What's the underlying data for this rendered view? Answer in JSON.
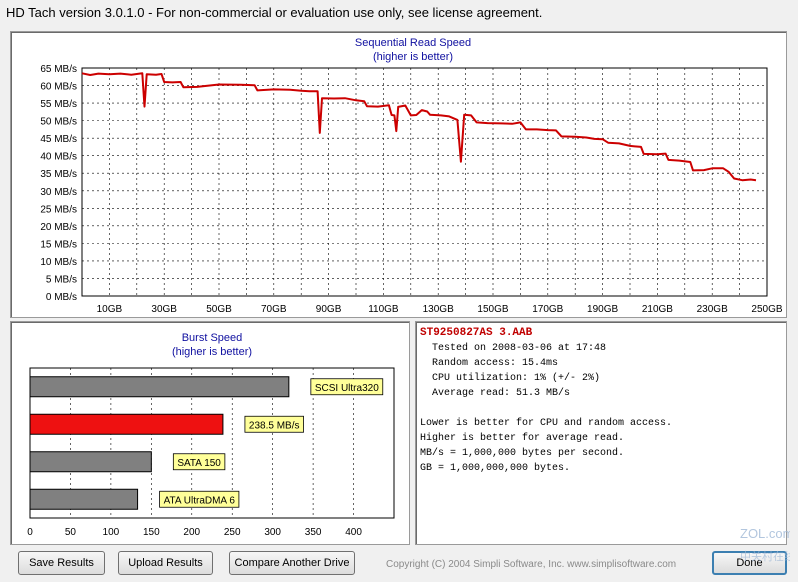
{
  "window": {
    "title": "HD Tach version 3.0.1.0  - For non-commercial or evaluation use only, see license agreement."
  },
  "chart_data": [
    {
      "type": "line",
      "title": "Sequential Read Speed",
      "subtitle": "(higher is better)",
      "xlabel": "",
      "ylabel": "",
      "x_unit": "GB",
      "y_unit": "MB/s",
      "xlim": [
        0,
        250
      ],
      "ylim": [
        0,
        65
      ],
      "grid": true,
      "y_ticks": [
        "65 MB/s",
        "60 MB/s",
        "55 MB/s",
        "50 MB/s",
        "45 MB/s",
        "40 MB/s",
        "35 MB/s",
        "30 MB/s",
        "25 MB/s",
        "20 MB/s",
        "15 MB/s",
        "10 MB/s",
        "5 MB/s",
        "0 MB/s"
      ],
      "x_ticks": [
        "10GB",
        "30GB",
        "50GB",
        "70GB",
        "90GB",
        "110GB",
        "130GB",
        "150GB",
        "170GB",
        "190GB",
        "210GB",
        "230GB",
        "250GB"
      ],
      "series": [
        {
          "color": "#cc0000",
          "points": [
            [
              0,
              63.5
            ],
            [
              3,
              63.0
            ],
            [
              6,
              63.4
            ],
            [
              10,
              63.2
            ],
            [
              14,
              63.4
            ],
            [
              18,
              63.1
            ],
            [
              22,
              63.5
            ],
            [
              22.8,
              54.0
            ],
            [
              23.6,
              63.2
            ],
            [
              27,
              63.1
            ],
            [
              29,
              63.3
            ],
            [
              30,
              61.0
            ],
            [
              33,
              60.9
            ],
            [
              36,
              61.0
            ],
            [
              37,
              59.5
            ],
            [
              42,
              59.6
            ],
            [
              50,
              60.3
            ],
            [
              58,
              60.2
            ],
            [
              63,
              60.1
            ],
            [
              64,
              58.6
            ],
            [
              70,
              58.9
            ],
            [
              76,
              58.8
            ],
            [
              80,
              58.5
            ],
            [
              83,
              58.4
            ],
            [
              86,
              58.4
            ],
            [
              86.8,
              46.5
            ],
            [
              87.6,
              56.4
            ],
            [
              92,
              56.3
            ],
            [
              96,
              56.4
            ],
            [
              100,
              55.8
            ],
            [
              103,
              55.5
            ],
            [
              104,
              54.1
            ],
            [
              108,
              54.0
            ],
            [
              112,
              54.4
            ],
            [
              113,
              51.6
            ],
            [
              114,
              51.5
            ],
            [
              114.7,
              47.0
            ],
            [
              115.4,
              53.9
            ],
            [
              118,
              54.3
            ],
            [
              120,
              51.5
            ],
            [
              122,
              51.6
            ],
            [
              124,
              53.0
            ],
            [
              126,
              52.6
            ],
            [
              127,
              51.7
            ],
            [
              131,
              51.5
            ],
            [
              134,
              51.2
            ],
            [
              137,
              50.2
            ],
            [
              138.3,
              38.3
            ],
            [
              139.5,
              51.7
            ],
            [
              142,
              51.5
            ],
            [
              144,
              49.5
            ],
            [
              148,
              49.3
            ],
            [
              153,
              49.2
            ],
            [
              157,
              49.1
            ],
            [
              160,
              49.5
            ],
            [
              162,
              47.5
            ],
            [
              166,
              47.5
            ],
            [
              170,
              47.3
            ],
            [
              173,
              47.2
            ],
            [
              175,
              45.5
            ],
            [
              180,
              45.4
            ],
            [
              184,
              45.2
            ],
            [
              187,
              44.8
            ],
            [
              190,
              44.7
            ],
            [
              192,
              43.7
            ],
            [
              196,
              43.5
            ],
            [
              200,
              42.8
            ],
            [
              204,
              42.5
            ],
            [
              205,
              40.5
            ],
            [
              210,
              40.4
            ],
            [
              213,
              40.6
            ],
            [
              214,
              38.8
            ],
            [
              218,
              38.6
            ],
            [
              222,
              38.2
            ],
            [
              223,
              35.8
            ],
            [
              227,
              35.9
            ],
            [
              230,
              36.4
            ],
            [
              234,
              36.4
            ],
            [
              236,
              35.4
            ],
            [
              238,
              33.5
            ],
            [
              241,
              33.0
            ],
            [
              244,
              33.2
            ],
            [
              246,
              33.0
            ]
          ]
        }
      ]
    },
    {
      "type": "bar",
      "orientation": "horizontal",
      "title": "Burst Speed",
      "subtitle": "(higher is better)",
      "xlim": [
        0,
        450
      ],
      "x_ticks": [
        "0",
        "50",
        "100",
        "150",
        "200",
        "250",
        "300",
        "350",
        "400"
      ],
      "bars": [
        {
          "label": "SCSI Ultra320",
          "value": 320,
          "color": "#808080"
        },
        {
          "label": "238.5 MB/s",
          "value": 238.5,
          "color": "#ee1111"
        },
        {
          "label": "SATA 150",
          "value": 150,
          "color": "#808080"
        },
        {
          "label": "ATA UltraDMA 6",
          "value": 133,
          "color": "#808080"
        }
      ]
    }
  ],
  "info": {
    "drive_name": "ST9250827AS 3.AAB",
    "tested_on": "Tested on 2008-03-06 at 17:48",
    "random_access": "Random access: 15.4ms",
    "cpu_utilization": "CPU utilization: 1% (+/- 2%)",
    "average_read": "Average read: 51.3 MB/s",
    "note1": "Lower is better for CPU and random access.",
    "note2": "Higher is better for average read.",
    "note3": "MB/s = 1,000,000 bytes per second.",
    "note4": "GB = 1,000,000,000 bytes."
  },
  "buttons": {
    "save": "Save Results",
    "upload": "Upload Results",
    "compare": "Compare Another Drive",
    "done": "Done"
  },
  "footer": {
    "copyright": "Copyright (C) 2004 Simpli Software, Inc. www.simplisoftware.com"
  },
  "watermark": {
    "text": "ZOL.com.cn",
    "subtext": "中关村在线"
  }
}
